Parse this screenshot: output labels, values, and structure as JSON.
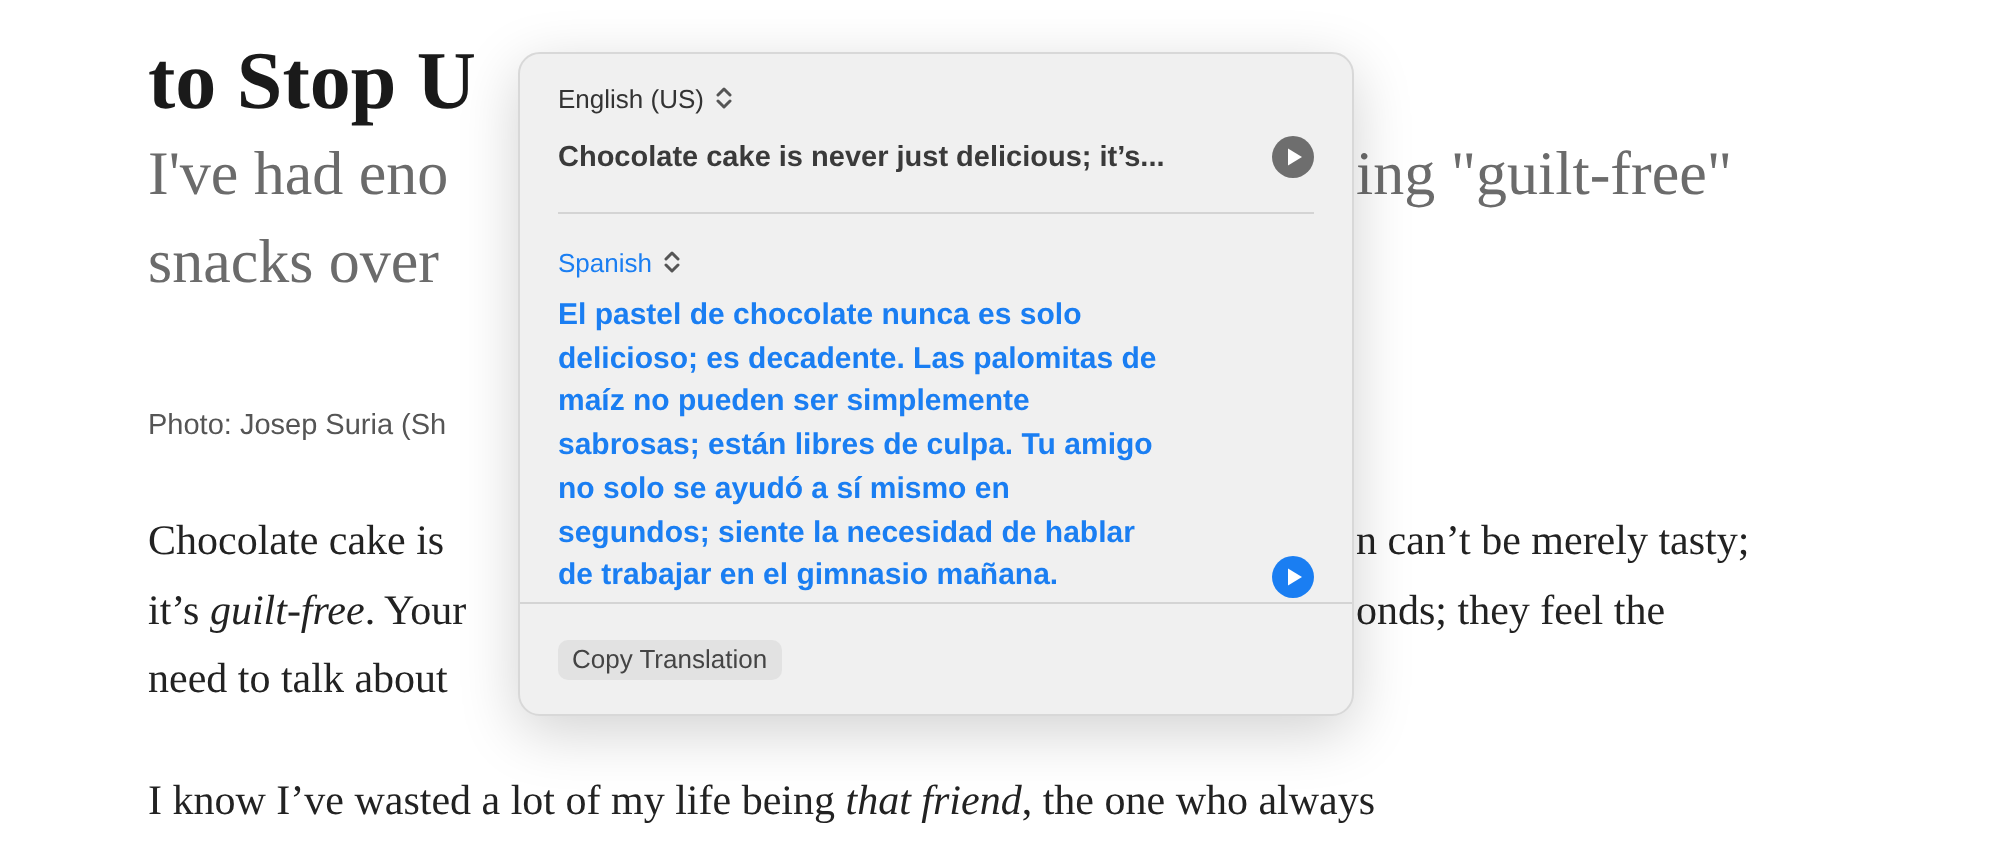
{
  "article": {
    "title": "to Stop U",
    "subtitle_lines": [
      {
        "left": "I've had eno",
        "right": "ing \"guilt-free\""
      },
      {
        "left": "snacks over"
      }
    ],
    "caption": "Photo: Josep Suria (Sh",
    "body_lines": [
      {
        "left": "Chocolate cake is",
        "right": "n can’t be merely tasty;"
      },
      {
        "left": "it’s *guilt-free*. Your",
        "right": "onds; they feel the"
      },
      {
        "left": "need to talk about"
      }
    ],
    "paragraph": "I know I’ve wasted a lot of my life being *that friend*, the one who always"
  },
  "translation_popover": {
    "source": {
      "language": "English (US)",
      "text": "Chocolate cake is never just delicious; it’s..."
    },
    "target": {
      "language": "Spanish",
      "text": "El pastel de chocolate nunca es solo delicioso; es decadente. Las palomitas de maíz no pueden ser simplemente sabrosas; están libres de culpa. Tu amigo no solo se ayudó a sí mismo en segundos; siente la necesidad de hablar de trabajar en el gimnasio mañana."
    },
    "copy_button": "Copy Translation"
  }
}
